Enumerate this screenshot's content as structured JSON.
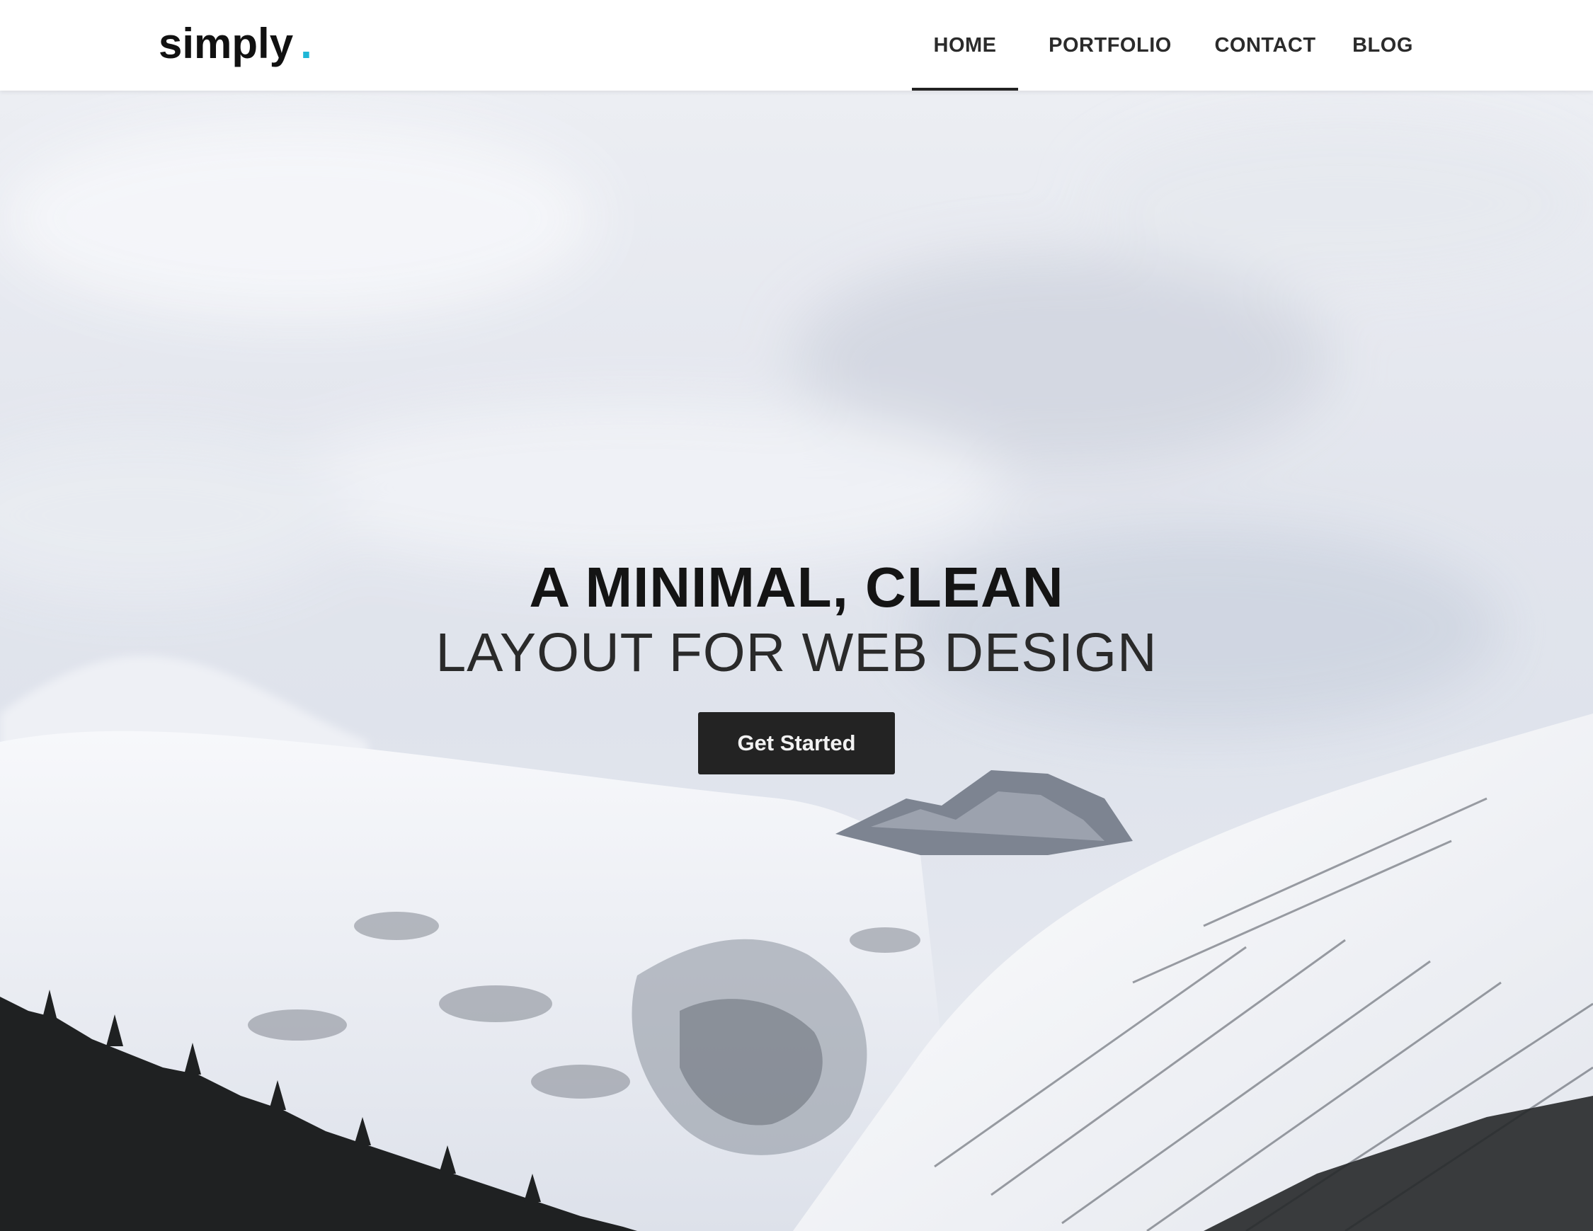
{
  "site": {
    "logo_text": "simply",
    "logo_dot": ".",
    "accent_color": "#1fb6d6"
  },
  "nav": {
    "items": [
      {
        "label": "HOME",
        "active": true
      },
      {
        "label": "PORTFOLIO",
        "active": false
      },
      {
        "label": "CONTACT",
        "active": false
      },
      {
        "label": "BLOG",
        "active": false
      }
    ]
  },
  "hero": {
    "headline_line1": "A MINIMAL, CLEAN",
    "headline_line2": "LAYOUT FOR WEB DESIGN",
    "cta_label": "Get Started",
    "background": "snowy-mountains-photo"
  }
}
